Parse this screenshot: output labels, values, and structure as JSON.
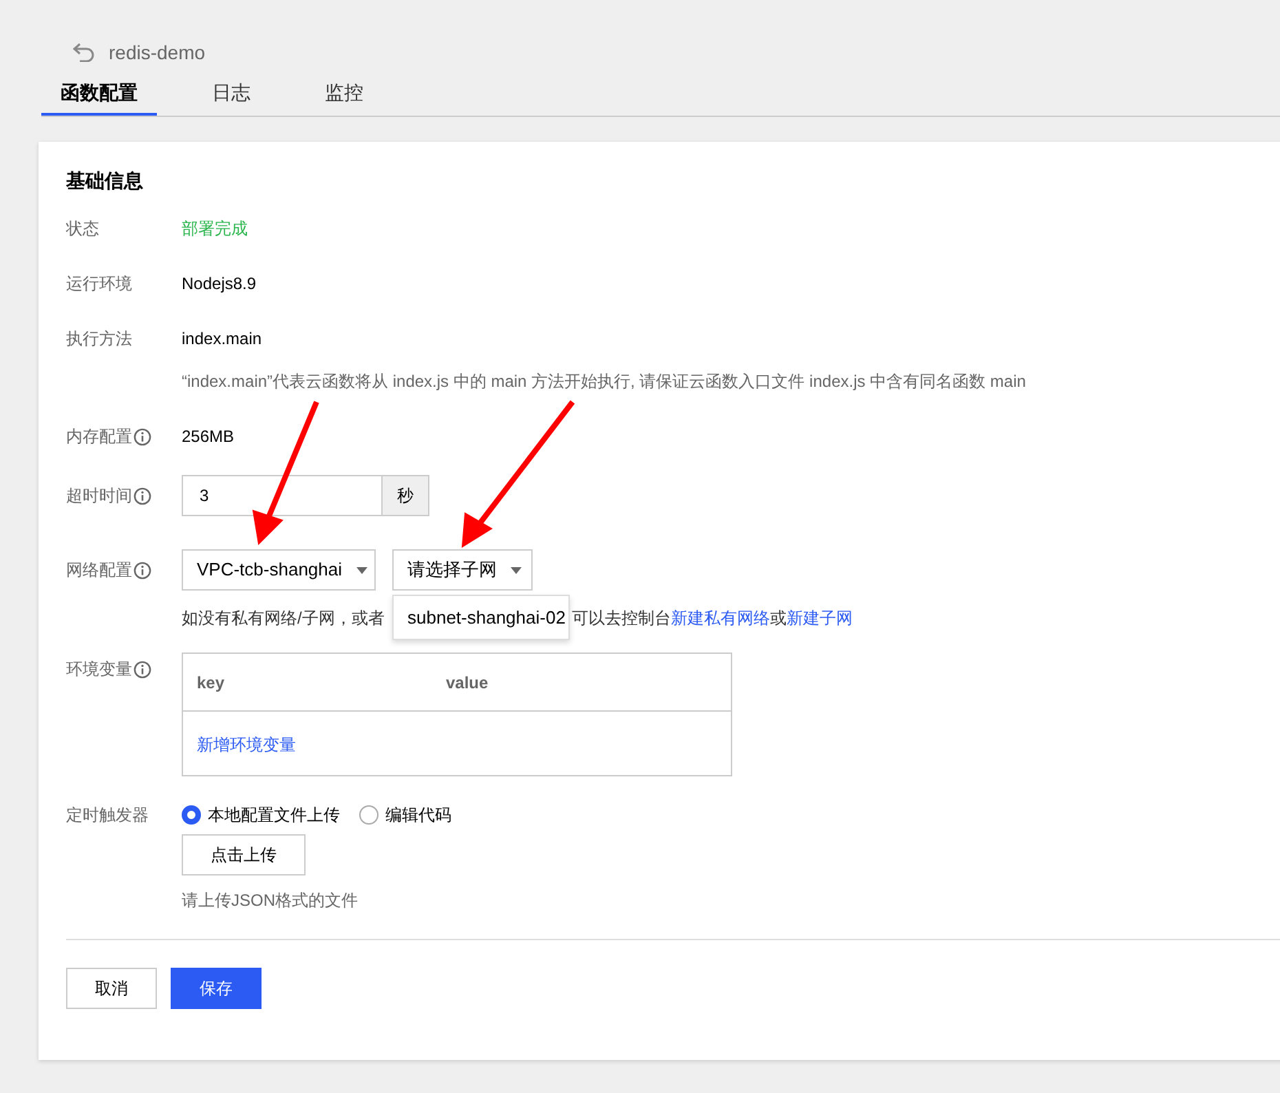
{
  "header": {
    "title": "redis-demo"
  },
  "tabs": [
    {
      "label": "函数配置",
      "selected": true
    },
    {
      "label": "日志",
      "selected": false
    },
    {
      "label": "监控",
      "selected": false
    }
  ],
  "section_title": "基础信息",
  "fields": [
    {
      "kind": "status",
      "label": "状态",
      "value": "部署完成"
    },
    {
      "kind": "text",
      "label": "运行环境",
      "value": "Nodejs8.9"
    },
    {
      "kind": "text",
      "label": "执行方法",
      "value": "index.main",
      "note": "“index.main”代表云函数将从 index.js 中的 main 方法开始执行, 请保证云函数入口文件 index.js 中含有同名函数 main"
    },
    {
      "kind": "text",
      "label": "内存配置",
      "info": true,
      "value": "256MB"
    },
    {
      "kind": "input",
      "label": "超时时间",
      "info": true,
      "value": "3",
      "unit": "秒"
    },
    {
      "kind": "network",
      "label": "网络配置",
      "info": true,
      "vpc": "VPC-tcb-shanghai",
      "subnet_placeholder": "请选择子网",
      "dropdown_option": "subnet-shanghai-02",
      "hint_before": "如没有私有网络/子网，或者",
      "hint_after": "可以去控制台",
      "link_vpc": "新建私有网络",
      "hint_or": "或",
      "link_subnet": "新建子网"
    },
    {
      "kind": "env",
      "label": "环境变量",
      "info": true,
      "columns": [
        "key",
        "value"
      ],
      "add_link": "新增环境变量"
    },
    {
      "kind": "trigger",
      "label": "定时触发器",
      "options": [
        {
          "label": "本地配置文件上传",
          "selected": true
        },
        {
          "label": "编辑代码",
          "selected": false
        }
      ],
      "upload_button": "点击上传",
      "hint": "请上传JSON格式的文件"
    }
  ],
  "buttons": [
    {
      "label": "取消",
      "kind": "default"
    },
    {
      "label": "保存",
      "kind": "primary"
    }
  ]
}
